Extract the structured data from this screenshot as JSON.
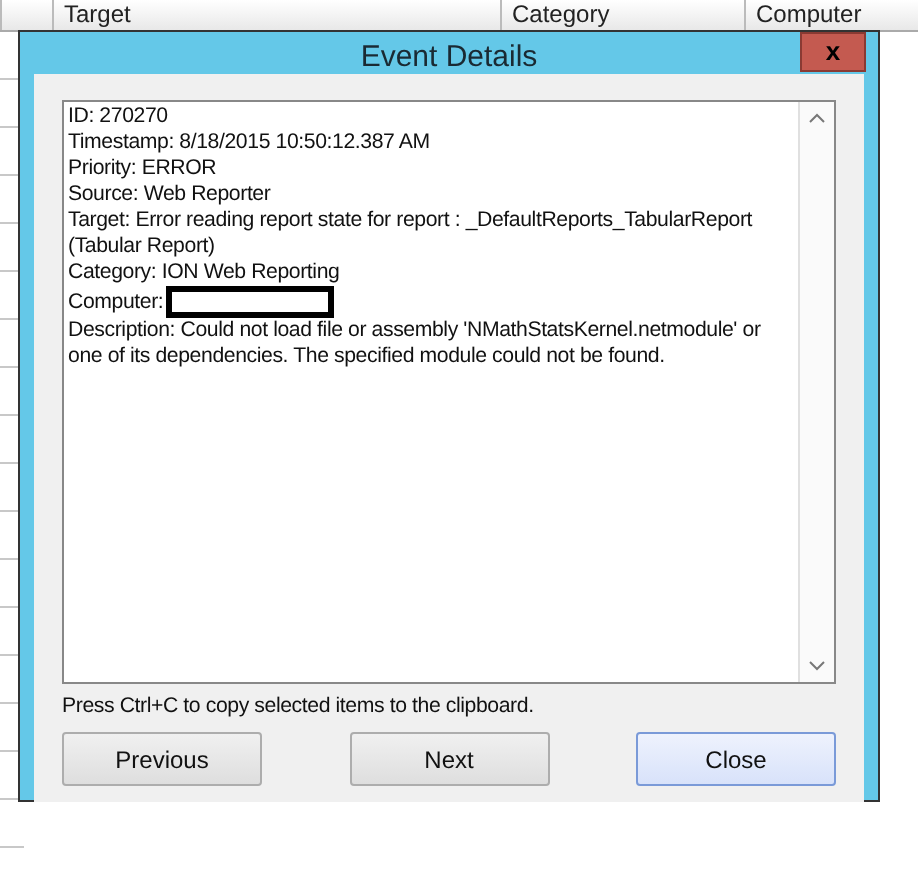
{
  "background_table": {
    "columns": [
      "Target",
      "Category",
      "Computer"
    ]
  },
  "window": {
    "title": "Event Details",
    "close_glyph": "x"
  },
  "details": {
    "lines": [
      {
        "kind": "text",
        "text": "ID: 270270"
      },
      {
        "kind": "text",
        "text": "Timestamp: 8/18/2015 10:50:12.387 AM"
      },
      {
        "kind": "text",
        "text": "Priority: ERROR"
      },
      {
        "kind": "text",
        "text": "Source: Web Reporter"
      },
      {
        "kind": "text",
        "text": "Target: Error reading report state for report : _DefaultReports_TabularReport (Tabular Report)"
      },
      {
        "kind": "text",
        "text": "Category: ION Web Reporting"
      },
      {
        "kind": "redacted",
        "text": "Computer:"
      },
      {
        "kind": "text",
        "text": "Description: Could not load file or assembly 'NMathStatsKernel.netmodule' or one of its dependencies. The specified module could not be found."
      }
    ]
  },
  "hint": "Press Ctrl+C to copy selected items to the clipboard.",
  "buttons": [
    {
      "label": "Previous",
      "default": false
    },
    {
      "label": "Next",
      "default": false
    },
    {
      "label": "Close",
      "default": true
    }
  ]
}
